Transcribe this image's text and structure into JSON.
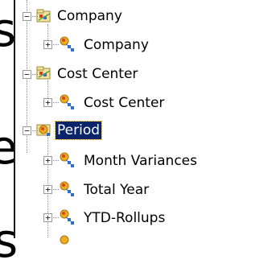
{
  "background_fragments": [
    "s",
    "e",
    "s"
  ],
  "tree": {
    "nodes": [
      {
        "label": "Company",
        "expander": "−"
      },
      {
        "label": "Company",
        "expander": "+"
      },
      {
        "label": "Cost Center",
        "expander": "−"
      },
      {
        "label": "Cost Center",
        "expander": "+"
      },
      {
        "label": "Period",
        "expander": "−"
      },
      {
        "label": "Month Variances",
        "expander": "+"
      },
      {
        "label": "Total Year",
        "expander": "+"
      },
      {
        "label": "YTD-Rollups",
        "expander": "+"
      }
    ],
    "selected_index": 4
  },
  "colors": {
    "selection": "#0a246a",
    "tree_lines": "#8c8c8c"
  }
}
